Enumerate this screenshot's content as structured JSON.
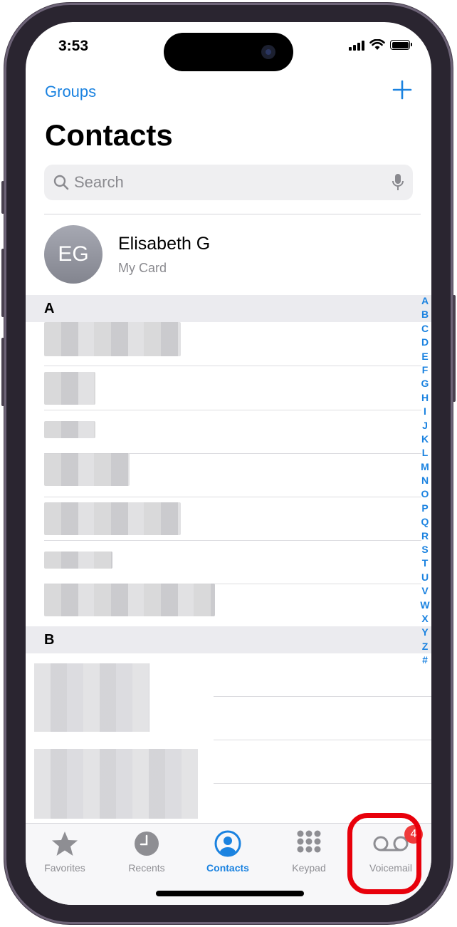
{
  "status_bar": {
    "time": "3:53"
  },
  "nav": {
    "groups_label": "Groups",
    "title": "Contacts"
  },
  "search": {
    "placeholder": "Search"
  },
  "my_card": {
    "initials": "EG",
    "name": "Elisabeth G",
    "subtitle": "My Card"
  },
  "sections": [
    {
      "letter": "A"
    },
    {
      "letter": "B"
    }
  ],
  "index_letters": [
    "A",
    "B",
    "C",
    "D",
    "E",
    "F",
    "G",
    "H",
    "I",
    "J",
    "K",
    "L",
    "M",
    "N",
    "O",
    "P",
    "Q",
    "R",
    "S",
    "T",
    "U",
    "V",
    "W",
    "X",
    "Y",
    "Z",
    "#"
  ],
  "tabs": [
    {
      "label": "Favorites",
      "icon": "star-icon"
    },
    {
      "label": "Recents",
      "icon": "clock-icon"
    },
    {
      "label": "Contacts",
      "icon": "person-circle-icon",
      "active": true
    },
    {
      "label": "Keypad",
      "icon": "keypad-icon"
    },
    {
      "label": "Voicemail",
      "icon": "voicemail-icon",
      "badge": "4"
    }
  ],
  "colors": {
    "accent": "#1a82e0",
    "badge": "#ef3b3b",
    "highlight": "#e8000b"
  }
}
